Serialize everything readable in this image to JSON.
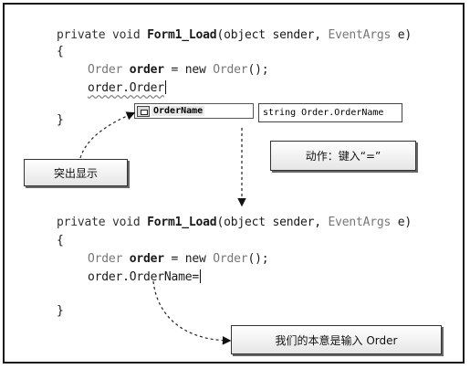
{
  "top_code": {
    "line1": {
      "p1": "private void ",
      "p2": "Form1_Load",
      "p3": "(object sender, ",
      "p4": "EventArgs",
      "p5": " e)"
    },
    "line2": "{",
    "line3": {
      "p1": "Order ",
      "p2": "order",
      "p3": " = new ",
      "p4": "Order",
      "p5": "();"
    },
    "line4": "order.Order",
    "line5": "}"
  },
  "intellisense": {
    "item": "OrderName"
  },
  "tooltip": {
    "text": "string Order.OrderName"
  },
  "labels": {
    "highlight": "突出显示",
    "action": "动作：键入“=”",
    "intent": "我们的本意是输入 Order"
  },
  "bottom_code": {
    "line1": {
      "p1": "private void ",
      "p2": "Form1_Load",
      "p3": "(object sender, ",
      "p4": "EventArgs",
      "p5": " e)"
    },
    "line2": "{",
    "line3": {
      "p1": "Order ",
      "p2": "order",
      "p3": " = new ",
      "p4": "Order",
      "p5": "();"
    },
    "line4": "order.OrderName=",
    "line5": "}"
  }
}
